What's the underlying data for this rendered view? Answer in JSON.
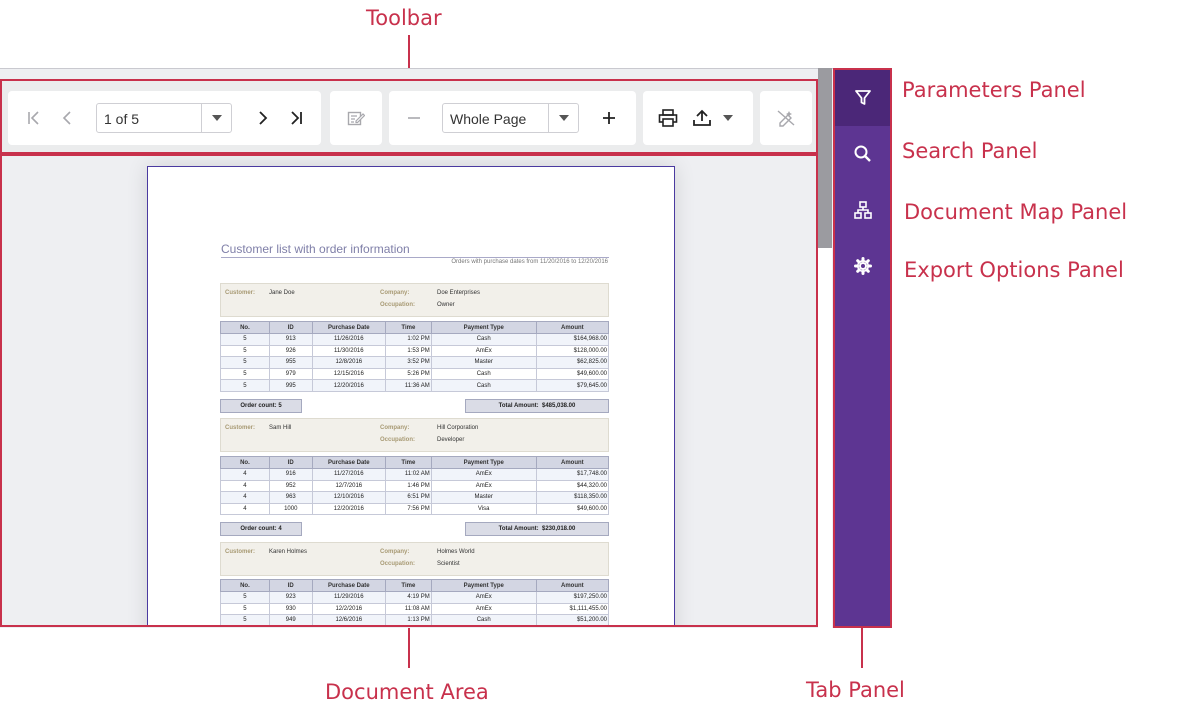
{
  "callouts": {
    "toolbar": "Toolbar",
    "parameters": "Parameters Panel",
    "search": "Search Panel",
    "document_map": "Document Map Panel",
    "export_options": "Export Options Panel",
    "document_area": "Document Area",
    "tab_panel": "Tab Panel"
  },
  "toolbar": {
    "page_value": "1 of 5",
    "zoom_value": "Whole Page"
  },
  "tabs": [
    {
      "name": "parameters",
      "icon": "filter-icon",
      "active": true
    },
    {
      "name": "search",
      "icon": "search-icon",
      "active": false
    },
    {
      "name": "document-map",
      "icon": "sitemap-icon",
      "active": false
    },
    {
      "name": "export-options",
      "icon": "gear-icon",
      "active": false
    }
  ],
  "colors": {
    "callout": "#c8314c",
    "tab_panel": "#5d3592",
    "tab_active": "#4b2778"
  },
  "report": {
    "title": "Customer list with order information",
    "subtitle": "Orders with purchase dates from 11/20/2016 to 12/20/2016",
    "labels": {
      "customer": "Customer:",
      "company": "Company:",
      "occupation": "Occupation:",
      "order_count": "Order count:",
      "total_amount": "Total Amount:"
    },
    "columns": [
      "No.",
      "ID",
      "Purchase Date",
      "Time",
      "Payment Type",
      "Amount"
    ],
    "groups": [
      {
        "customer": "Jane Doe",
        "company": "Doe Enterprises",
        "occupation": "Owner",
        "order_count": "5",
        "total": "$485,038.00",
        "rows": [
          [
            "5",
            "913",
            "11/26/2016",
            "1:02 PM",
            "Cash",
            "$164,968.00"
          ],
          [
            "5",
            "926",
            "11/30/2016",
            "1:53 PM",
            "AmEx",
            "$128,000.00"
          ],
          [
            "5",
            "955",
            "12/8/2016",
            "3:52 PM",
            "Master",
            "$62,825.00"
          ],
          [
            "5",
            "979",
            "12/15/2016",
            "5:26 PM",
            "Cash",
            "$49,600.00"
          ],
          [
            "5",
            "995",
            "12/20/2016",
            "11:36 AM",
            "Cash",
            "$79,645.00"
          ]
        ]
      },
      {
        "customer": "Sam Hill",
        "company": "Hill Corporation",
        "occupation": "Developer",
        "order_count": "4",
        "total": "$230,018.00",
        "rows": [
          [
            "4",
            "916",
            "11/27/2016",
            "11:02 AM",
            "AmEx",
            "$17,748.00"
          ],
          [
            "4",
            "952",
            "12/7/2016",
            "1:46 PM",
            "AmEx",
            "$44,320.00"
          ],
          [
            "4",
            "963",
            "12/10/2016",
            "6:51 PM",
            "Master",
            "$118,350.00"
          ],
          [
            "4",
            "1000",
            "12/20/2016",
            "7:56 PM",
            "Visa",
            "$49,600.00"
          ]
        ]
      },
      {
        "customer": "Karen Holmes",
        "company": "Holmes World",
        "occupation": "Scientist",
        "rows": [
          [
            "5",
            "923",
            "11/29/2016",
            "4:19 PM",
            "AmEx",
            "$197,250.00"
          ],
          [
            "5",
            "930",
            "12/2/2016",
            "11:08 AM",
            "AmEx",
            "$1,111,455.00"
          ],
          [
            "5",
            "949",
            "12/6/2016",
            "1:13 PM",
            "Cash",
            "$51,200.00"
          ]
        ]
      }
    ]
  }
}
